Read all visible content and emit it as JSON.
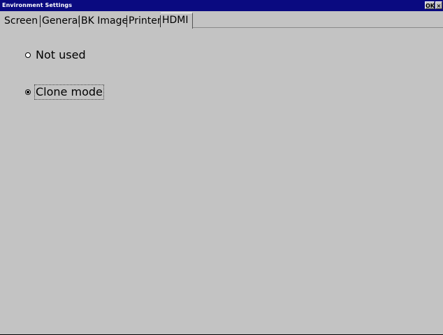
{
  "window": {
    "title": "Environment Settings",
    "ok_label": "OK",
    "close_label": "×"
  },
  "tabs": [
    {
      "label": "Screen",
      "active": false
    },
    {
      "label": "General",
      "active": false
    },
    {
      "label": "BK Image",
      "active": false
    },
    {
      "label": "Printer",
      "active": false
    },
    {
      "label": "HDMI",
      "active": true
    }
  ],
  "hdmi": {
    "options": [
      {
        "label": "Not used",
        "checked": false
      },
      {
        "label": "Clone mode",
        "checked": true
      }
    ]
  }
}
